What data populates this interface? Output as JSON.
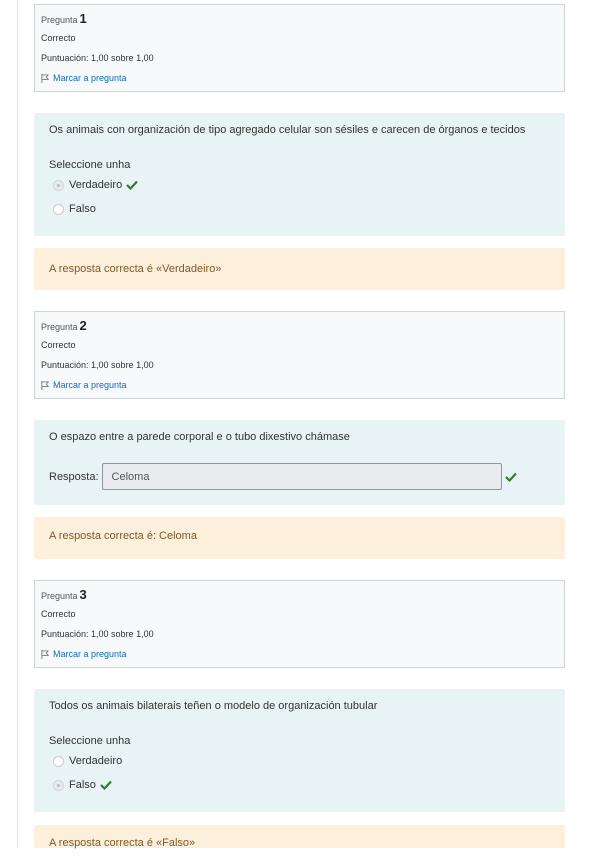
{
  "questions": [
    {
      "number_label": "Pregunta",
      "number": "1",
      "state": "Correcto",
      "grade": "Puntuación: 1,00 sobre 1,00",
      "flag": "Marcar a pregunta",
      "text": "Os animais con organización de tipo agregado celular son sésiles e carecen de órganos e tecidos",
      "prompt": "Seleccione unha",
      "options": [
        {
          "label": "Verdadeiro",
          "selected": true,
          "correct_mark": true
        },
        {
          "label": "Falso",
          "selected": false,
          "correct_mark": false
        }
      ],
      "feedback": "A resposta correcta é «Verdadeiro»"
    },
    {
      "number_label": "Pregunta",
      "number": "2",
      "state": "Correcto",
      "grade": "Puntuación: 1,00 sobre 1,00",
      "flag": "Marcar a pregunta",
      "text": "O espazo entre a parede corporal e o tubo dixestivo chámase",
      "answer_label": "Resposta:",
      "answer_value": "Celoma",
      "feedback": "A resposta correcta é: Celoma"
    },
    {
      "number_label": "Pregunta",
      "number": "3",
      "state": "Correcto",
      "grade": "Puntuación: 1,00 sobre 1,00",
      "flag": "Marcar a pregunta",
      "text": "Todos os animais bilaterais teñen o modelo de organización tubular",
      "prompt": "Seleccione unha",
      "options": [
        {
          "label": "Verdadeiro",
          "selected": false,
          "correct_mark": false
        },
        {
          "label": "Falso",
          "selected": true,
          "correct_mark": true
        }
      ],
      "feedback": "A resposta correcta é «Falso»"
    }
  ],
  "colors": {
    "info_bg": "#f8f9fa",
    "content_bg": "#e7f3f5",
    "feedback_bg": "#fcefdc",
    "feedback_text": "#7d5a29",
    "link": "#0f6cbf",
    "check": "#357a32"
  },
  "icons": {
    "flag": "flag-icon",
    "check": "check-icon"
  }
}
